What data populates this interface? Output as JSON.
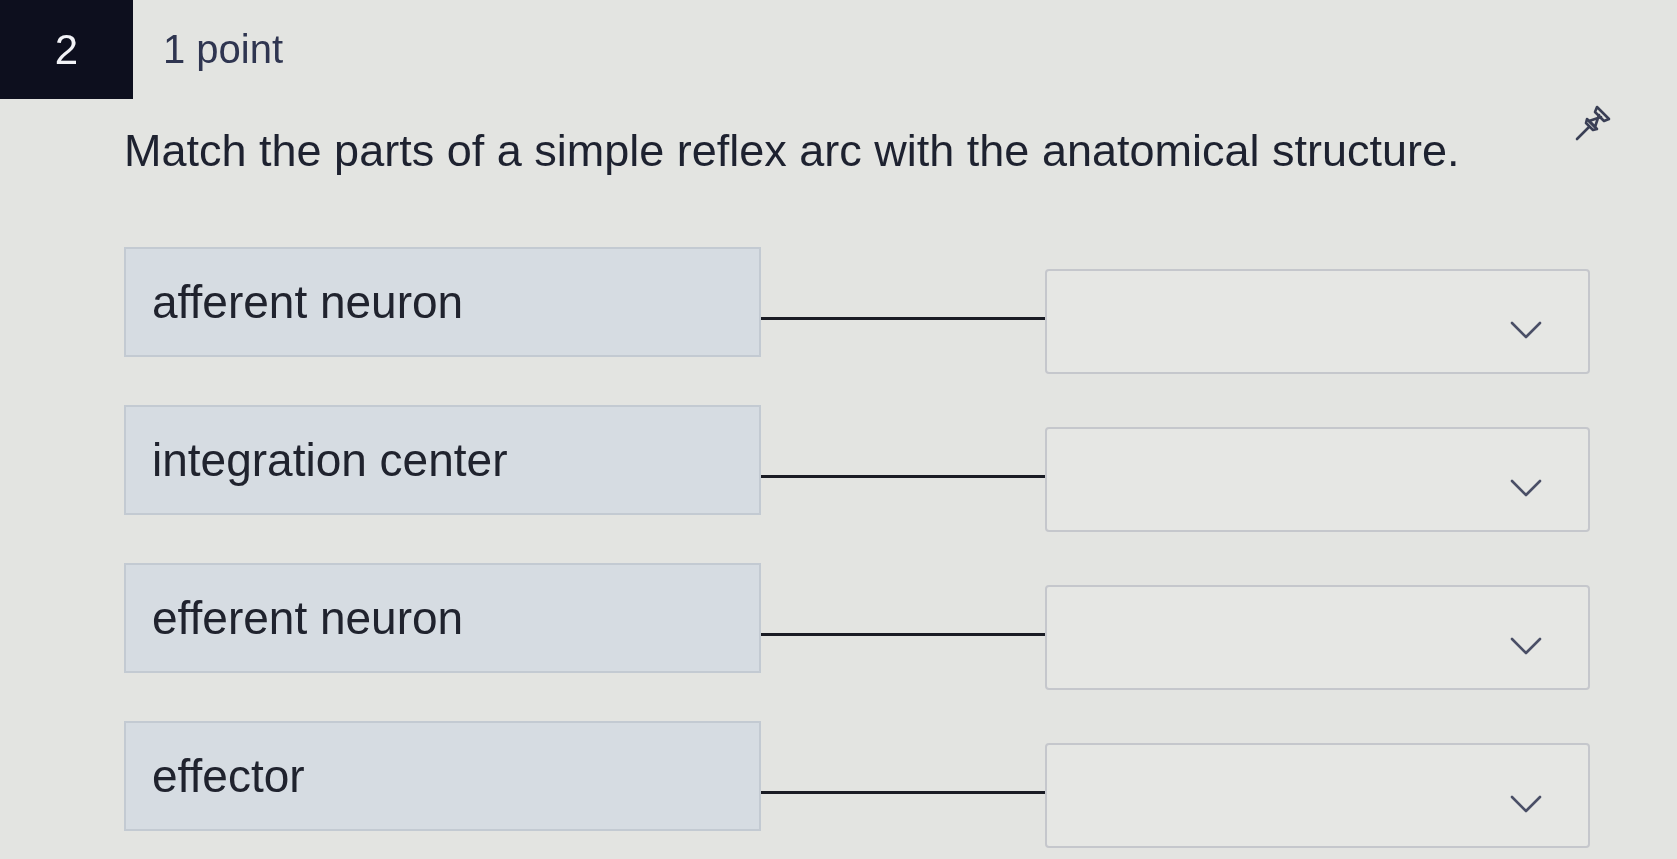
{
  "question": {
    "number": "2",
    "points": "1 point",
    "prompt": "Match the parts of a simple reflex arc with the anatomical structure."
  },
  "pairs": [
    {
      "term": "afferent neuron"
    },
    {
      "term": "integration center"
    },
    {
      "term": "efferent neuron"
    },
    {
      "term": "effector"
    }
  ]
}
